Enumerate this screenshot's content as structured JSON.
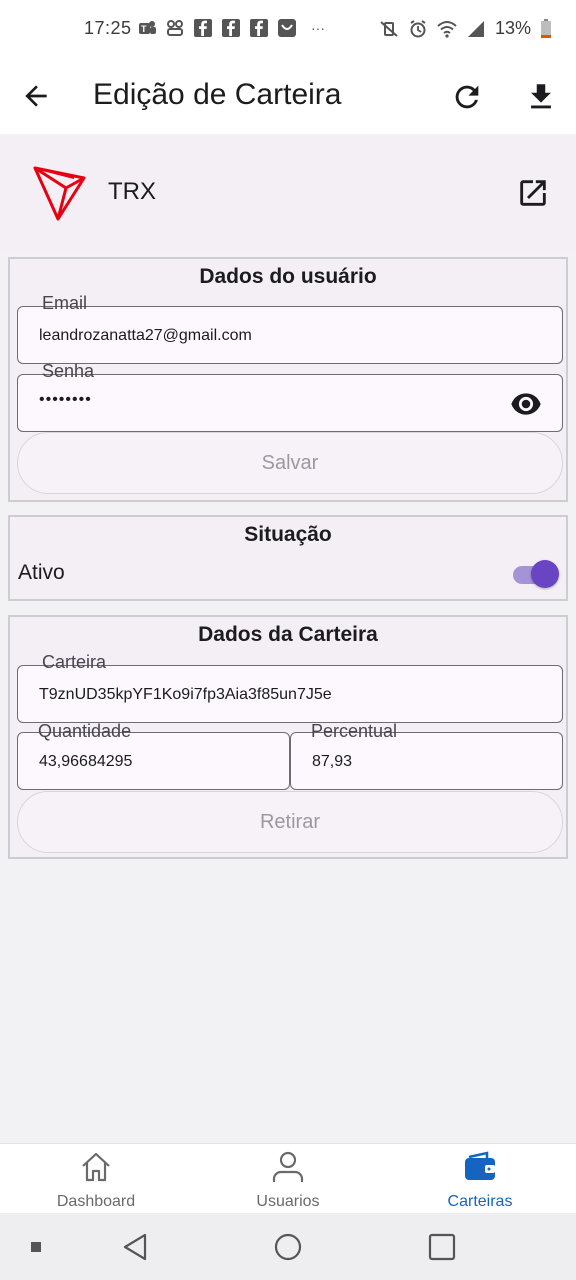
{
  "status_bar": {
    "time": "17:25",
    "battery_percent": "13%",
    "overflow": "···",
    "notification_icons": [
      "teams-icon",
      "teams-icon",
      "facebook-icon",
      "facebook-icon",
      "facebook-icon",
      "inbox-icon"
    ],
    "system_icons": [
      "vibrate-off-icon",
      "alarm-icon",
      "wifi-icon",
      "signal-icon",
      "battery-icon"
    ]
  },
  "app_bar": {
    "title": "Edição de Carteira"
  },
  "coin": {
    "name": "TRX",
    "logo_color": "#e60012"
  },
  "user_section": {
    "title": "Dados do usuário",
    "email_label": "Email",
    "email_value": "leandrozanatta27@gmail.com",
    "password_label": "Senha",
    "password_value": "••••••••",
    "save_label": "Salvar"
  },
  "status_section": {
    "title": "Situação",
    "active_label": "Ativo",
    "active": true
  },
  "wallet_section": {
    "title": "Dados da Carteira",
    "wallet_label": "Carteira",
    "wallet_value": "T9znUD35kpYF1Ko9i7fp3Aia3f85un7J5e",
    "quantity_label": "Quantidade",
    "quantity_value": "43,96684295",
    "percent_label": "Percentual",
    "percent_value": "87,93",
    "withdraw_label": "Retirar"
  },
  "bottom_nav": {
    "items": [
      {
        "label": "Dashboard",
        "icon": "home-icon",
        "active": false
      },
      {
        "label": "Usuarios",
        "icon": "person-icon",
        "active": false
      },
      {
        "label": "Carteiras",
        "icon": "wallet-icon",
        "active": true
      }
    ]
  },
  "colors": {
    "accent": "#6944c3",
    "active_nav": "#1565c0"
  }
}
